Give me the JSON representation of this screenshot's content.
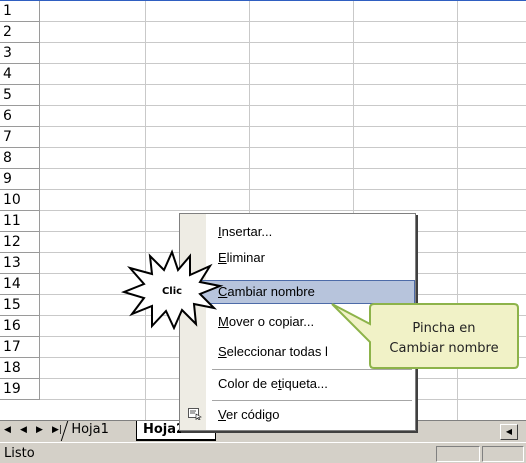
{
  "rows": [
    "1",
    "2",
    "3",
    "4",
    "5",
    "6",
    "7",
    "8",
    "9",
    "10",
    "11",
    "12",
    "13",
    "14",
    "15",
    "16",
    "17",
    "18",
    "19"
  ],
  "context_menu": {
    "items": [
      {
        "pre": "",
        "u": "I",
        "post": "nsertar..."
      },
      {
        "pre": "",
        "u": "E",
        "post": "liminar"
      },
      {
        "pre": "",
        "u": "C",
        "post": "ambiar nombre"
      },
      {
        "pre": "",
        "u": "M",
        "post": "over o copiar..."
      },
      {
        "pre": "",
        "u": "S",
        "post": "eleccionar todas l"
      },
      {
        "pre": "Color de e",
        "u": "t",
        "post": "iqueta..."
      },
      {
        "pre": "",
        "u": "V",
        "post": "er código"
      }
    ],
    "highlighted_index": 2
  },
  "sheet_tabs": {
    "tab1": "Hoja1",
    "tab2": "Hoja2"
  },
  "status": {
    "text": "Listo"
  },
  "callout": {
    "line1": "Pincha en",
    "line2": "Cambiar nombre",
    "fill": "#f1f2c7",
    "stroke": "#8db34a"
  },
  "click_label": {
    "text": "Clic"
  },
  "icons": {
    "code": "view-code-icon",
    "nav_first": "nav-first-icon",
    "nav_prev": "nav-prev-icon",
    "nav_next": "nav-next-icon",
    "nav_last": "nav-last-icon"
  }
}
